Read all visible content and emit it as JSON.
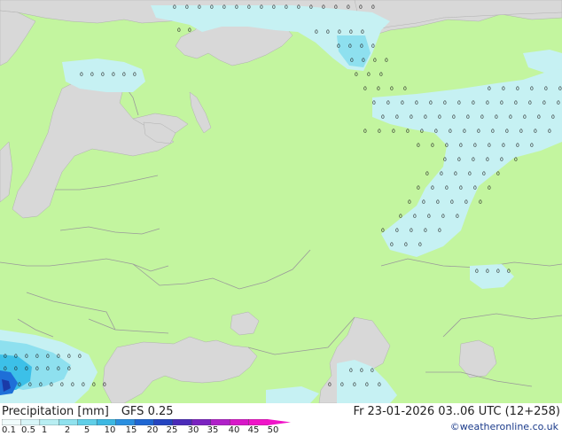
{
  "map": {
    "colors": {
      "land": "#c3f59f",
      "sea": "#d8d8d8",
      "border": "#9a9a9a",
      "precip_light": "#c6f1f3",
      "precip_mid": "#8ee0ef",
      "precip_strong": "#3cc0e8",
      "precip_heavy": "#1e6fd8",
      "precip_extreme": "#1a3aa8"
    },
    "precip_dot_glyph": "0"
  },
  "footer": {
    "title": "Precipitation [mm]",
    "model": "GFS 0.25",
    "datetime": "Fr 23-01-2026 03..06 UTC (12+258)",
    "credit": "©weatheronline.co.uk"
  },
  "legend": {
    "labels": [
      "0.1",
      "0.5",
      "1",
      "2",
      "5",
      "10",
      "15",
      "20",
      "25",
      "30",
      "35",
      "40",
      "45",
      "50"
    ],
    "colors": [
      "#f0fcfc",
      "#d8f6f8",
      "#b8eef2",
      "#90e2ee",
      "#60cfe8",
      "#3cb8e2",
      "#2a8fe0",
      "#1e66d2",
      "#2444c0",
      "#4a2ab8",
      "#7a22c0",
      "#b020c8",
      "#d818c8",
      "#f014c8"
    ]
  }
}
